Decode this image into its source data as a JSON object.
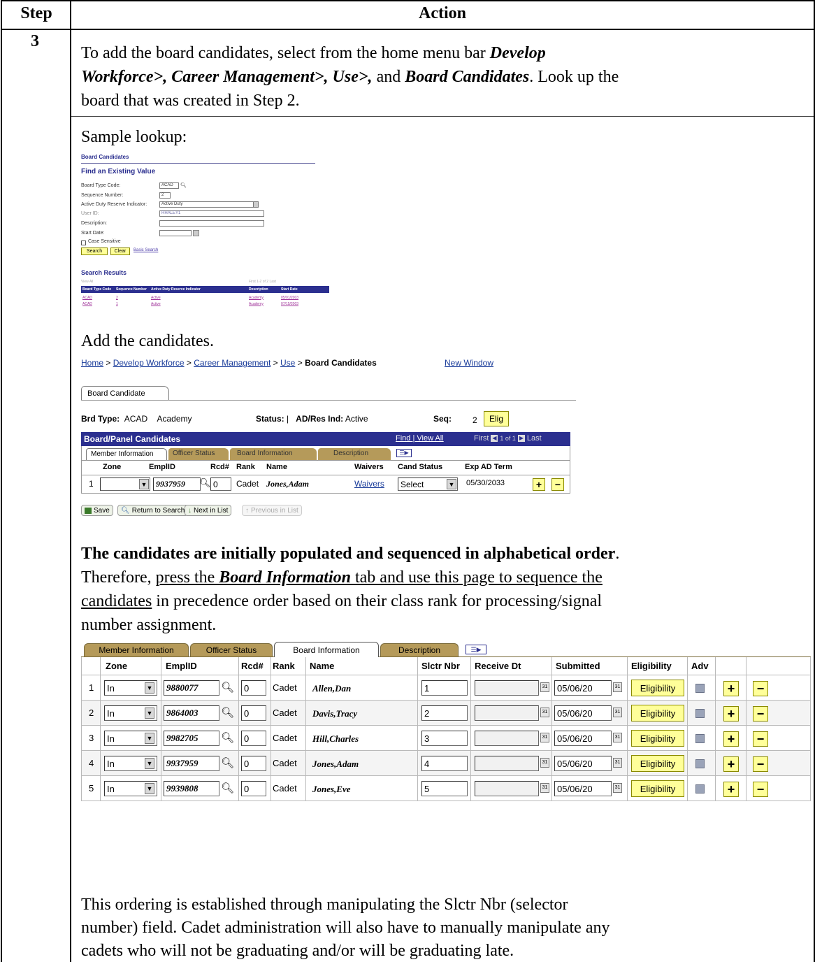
{
  "table": {
    "col_step": "Step",
    "col_action": "Action",
    "step_number": "3"
  },
  "intro": {
    "line1_a": "To add the board candidates, select from the home menu bar ",
    "line1_b": "Develop",
    "line2_b": "Workforce>, Career Management>, Use>,",
    "line2_c": " and ",
    "line2_d": "Board Candidates",
    "line2_e": ".  Look up the",
    "line3": "board that was created in Step 2."
  },
  "sample_lookup_label": "Sample lookup:",
  "lookup": {
    "page_title": "Board Candidates",
    "heading": "Find an Existing Value",
    "fields": [
      {
        "label": "Board Type Code:",
        "value": "ACAD"
      },
      {
        "label": "Sequence Number:",
        "value": "2"
      },
      {
        "label": "Active Duty Reserve Indicator:",
        "value": "Active Duty"
      },
      {
        "label": "User ID:",
        "value": "RHALEY1"
      },
      {
        "label": "Description:",
        "value": ""
      },
      {
        "label": "Start Date:",
        "value": ""
      }
    ],
    "case_sensitive": "Case Sensitive",
    "search_btn": "Search",
    "clear_btn": "Clear",
    "basic_search": "Basic Search",
    "results_title": "Search Results",
    "view_all": "View All",
    "nav": "First  1-2 of 2  Last",
    "headers": [
      "Board Type Code",
      "Sequence Number",
      "Active Duty Reserve Indicator",
      "Description",
      "Start Date"
    ],
    "rows": [
      [
        "ACAD",
        "2",
        "Active",
        "Academy",
        "05/01/2003"
      ],
      [
        "ACAD",
        "1",
        "Active",
        "Academy",
        "07/15/2003"
      ]
    ]
  },
  "add_label": "Add the candidates.",
  "bc": {
    "breadcrumb": [
      "Home",
      "Develop Workforce",
      "Career Management",
      "Use"
    ],
    "breadcrumb_sep": ">",
    "breadcrumb_current": "Board Candidates",
    "new_window": "New Window",
    "tab": "Board Candidate",
    "brd_type_label": "Brd Type:",
    "brd_type_value": "ACAD",
    "brd_type_desc": "Academy",
    "status_label": "Status:",
    "status_value": "|",
    "adres_label": "AD/Res Ind:",
    "adres_value": "Active",
    "seq_label": "Seq:",
    "seq_value": "2",
    "elig_btn": "Elig",
    "grid_title": "Board/Panel Candidates",
    "grid_links": "Find | View All",
    "grid_nav_first": "First",
    "grid_nav_count": "1 of 1",
    "grid_nav_last": "Last",
    "subtabs": [
      "Member Information",
      "Officer Status",
      "Board Information",
      "Description"
    ],
    "cols": [
      "Zone",
      "EmplID",
      "Rcd#",
      "Rank",
      "Name",
      "Waivers",
      "Cand Status",
      "Exp AD Term"
    ],
    "row": {
      "num": "1",
      "zone": "",
      "emplid": "9937959",
      "rcd": "0",
      "rank": "Cadet",
      "name": "Jones,Adam",
      "waivers": "Waivers",
      "cand_status": "Select",
      "exp": "05/30/2033"
    },
    "buttons": {
      "save": "Save",
      "return": "Return to Search",
      "next": "Next in List",
      "prev": "Previous in List"
    }
  },
  "para": {
    "bold": "The candidates are initially populated and sequenced in alphabetical order",
    "bold_end": ".",
    "l2_a": "Therefore, ",
    "l2_b": "press the ",
    "l2_c": "Board Information",
    "l2_d": " tab and use this page to sequence the",
    "l3_a": "candidates",
    "l3_b": " in precedence order based on their class rank for processing/signal",
    "l4": "number assignment."
  },
  "grid2": {
    "tabs": [
      "Member Information",
      "Officer Status",
      "Board Information",
      "Description"
    ],
    "cols": [
      "Zone",
      "EmplID",
      "Rcd#",
      "Rank",
      "Name",
      "Slctr Nbr",
      "Receive Dt",
      "Submitted",
      "Eligibility",
      "Adv"
    ],
    "rows": [
      {
        "num": "1",
        "zone": "In",
        "emplid": "9880077",
        "rcd": "0",
        "rank": "Cadet",
        "name": "Allen,Dan",
        "slctr": "1",
        "recv": "",
        "sub": "05/06/20",
        "elig": "Eligibility"
      },
      {
        "num": "2",
        "zone": "In",
        "emplid": "9864003",
        "rcd": "0",
        "rank": "Cadet",
        "name": "Davis,Tracy",
        "slctr": "2",
        "recv": "",
        "sub": "05/06/20",
        "elig": "Eligibility"
      },
      {
        "num": "3",
        "zone": "In",
        "emplid": "9982705",
        "rcd": "0",
        "rank": "Cadet",
        "name": "Hill,Charles",
        "slctr": "3",
        "recv": "",
        "sub": "05/06/20",
        "elig": "Eligibility"
      },
      {
        "num": "4",
        "zone": "In",
        "emplid": "9937959",
        "rcd": "0",
        "rank": "Cadet",
        "name": "Jones,Adam",
        "slctr": "4",
        "recv": "",
        "sub": "05/06/20",
        "elig": "Eligibility"
      },
      {
        "num": "5",
        "zone": "In",
        "emplid": "9939808",
        "rcd": "0",
        "rank": "Cadet",
        "name": "Jones,Eve",
        "slctr": "5",
        "recv": "",
        "sub": "05/06/20",
        "elig": "Eligibility"
      }
    ]
  },
  "closing": {
    "l1": "This ordering is established through manipulating the Slctr Nbr (selector",
    "l2": "number) field.  Cadet administration will also have to manually manipulate any",
    "l3": "cadets who will not be graduating and/or will be graduating late."
  },
  "colors": {
    "peoplesoft_blue": "#2b2f8f",
    "tab_tan": "#b59a5a",
    "yellow_button": "#ffff99"
  }
}
